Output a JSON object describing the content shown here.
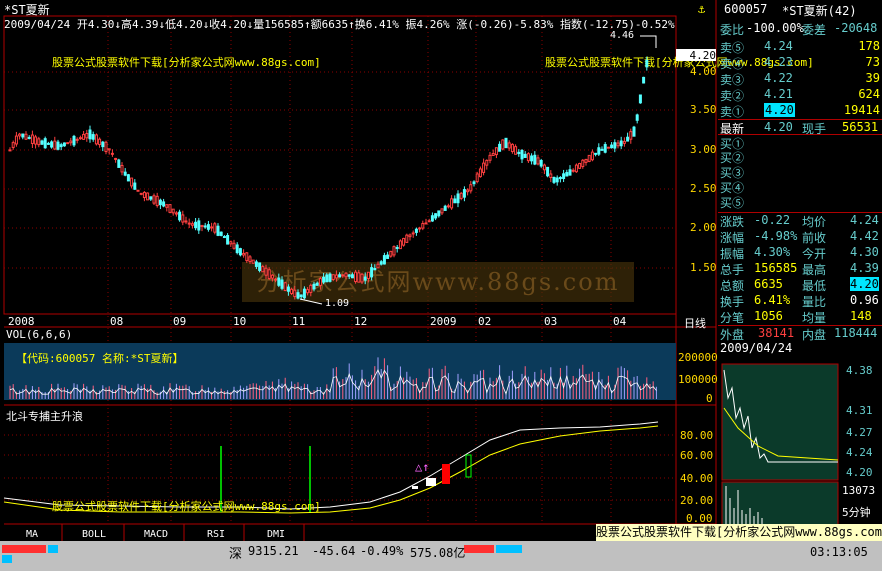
{
  "header": {
    "stock_name": "*ST夏新",
    "quote_line": "2009/04/24  开4.30↓高4.39↓低4.20↓收4.20↓量156585↑额6635↑换6.41% 振4.26% 涨(-0.26)-5.83% 指数(-12.75)-0.52%",
    "watermark_1": "股票公式股票软件下载[分析家公式网www.88gs.com]",
    "watermark_2": "股票公式股票软件下载[分析家公式网www.88gs.com]"
  },
  "price_chart": {
    "price_ticks": [
      "4.00",
      "3.50",
      "3.00",
      "2.50",
      "2.00",
      "1.50"
    ],
    "current_price_tag": "4.20",
    "high_marker": "4.46",
    "low_marker": "1.09",
    "months": [
      "2008",
      "08",
      "09",
      "10",
      "11",
      "12",
      "2009",
      "02",
      "03",
      "04"
    ],
    "period_label": "日线",
    "big_watermark": "分析家公式网www.88gs.com"
  },
  "volume_panel": {
    "label": "VOL(6,6,6)",
    "code_label": "【代码:600057 名称:*ST夏新】",
    "vol_ticks": [
      "200000",
      "100000",
      "0"
    ]
  },
  "indicator_panel": {
    "label": "北斗专捕主升浪",
    "ticks": [
      "80.00",
      "60.00",
      "40.00",
      "20.00",
      "0.00"
    ],
    "watermark": "股票公式股票软件下载[分析家公式网www.88gs.com]",
    "signal_glyph": "△↑"
  },
  "tabs": [
    "MA",
    "BOLL",
    "MACD",
    "RSI",
    "DMI"
  ],
  "quote_panel": {
    "code": "600057",
    "name": "*ST夏新(42)",
    "weibi_label": "委比",
    "weibi_value": "-100.00%",
    "weicha_label": "委差",
    "weicha_value": "-20648",
    "asks": [
      {
        "label": "卖⑤",
        "price": "4.24",
        "vol": "178"
      },
      {
        "label": "卖④",
        "price": "4.23",
        "vol": "73"
      },
      {
        "label": "卖③",
        "price": "4.22",
        "vol": "39"
      },
      {
        "label": "卖②",
        "price": "4.21",
        "vol": "624"
      },
      {
        "label": "卖①",
        "price": "4.20",
        "vol": "19414"
      }
    ],
    "last_label": "最新",
    "last_value": "4.20",
    "hand_label": "现手",
    "hand_value": "56531",
    "bids": [
      "买①",
      "买②",
      "买③",
      "买④",
      "买⑤"
    ],
    "stats": [
      {
        "l1": "涨跌",
        "v1": "-0.22",
        "l2": "均价",
        "v2": "4.24"
      },
      {
        "l1": "涨幅",
        "v1": "-4.98%",
        "l2": "前收",
        "v2": "4.42"
      },
      {
        "l1": "振幅",
        "v1": "4.30%",
        "l2": "今开",
        "v2": "4.30"
      },
      {
        "l1": "总手",
        "v1": "156585",
        "l2": "最高",
        "v2": "4.39"
      },
      {
        "l1": "总额",
        "v1": "6635",
        "l2": "最低",
        "v2": "4.20"
      },
      {
        "l1": "换手",
        "v1": "6.41%",
        "l2": "量比",
        "v2": "0.96"
      },
      {
        "l1": "分笔",
        "v1": "1056",
        "l2": "均量",
        "v2": "148"
      }
    ],
    "outer_label": "外盘",
    "outer_value": "38141",
    "inner_label": "内盘",
    "inner_value": "118444",
    "date": "2009/04/24",
    "mini_ticks": [
      "4.38",
      "4.31",
      "4.27",
      "4.24",
      "4.20"
    ],
    "mini_vol": "13073",
    "mini_label": "5分钟"
  },
  "status_bar": {
    "index_label": "深",
    "index_value": "9315.21",
    "index_change": "-45.64",
    "index_pct": "-0.49%",
    "index_amount": "575.08亿",
    "time": "03:13:05"
  },
  "bottom_watermark": "股票公式股票软件下载[分析家公式网www.88gs.com]"
}
